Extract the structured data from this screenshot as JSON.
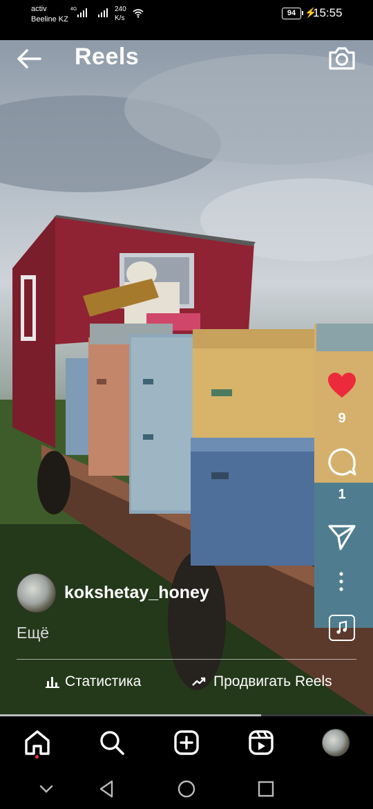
{
  "status_bar": {
    "carrier_line1": "activ",
    "carrier_line2": "Beeline KZ",
    "network_type": "4G",
    "speed_value": "240",
    "speed_unit": "K/s",
    "battery_level": "94",
    "time": "15:55"
  },
  "header": {
    "title": "Reels",
    "back_icon": "arrow-left-icon",
    "camera_icon": "camera-icon"
  },
  "actions": {
    "like_icon": "heart-filled-icon",
    "like_color": "#ed2a3c",
    "like_count": "9",
    "comment_icon": "comment-bubble-icon",
    "comment_count": "1",
    "share_icon": "paper-plane-icon",
    "more_icon": "vertical-dots-icon",
    "audio_icon": "music-note-icon"
  },
  "post": {
    "username": "kokshetay_honey",
    "more_label": "Ещё",
    "stats_label": "Статистика",
    "stats_icon": "bar-chart-icon",
    "promote_label": "Продвигать Reels",
    "promote_icon": "trending-up-icon"
  },
  "playback": {
    "progress_fraction": 0.7
  },
  "bottom_nav": {
    "items": [
      "home-icon",
      "search-icon",
      "create-plus-icon",
      "reels-icon",
      "profile-avatar"
    ],
    "active": "home-icon",
    "notification_dot_color": "#ff3040"
  },
  "system_nav": {
    "items": [
      "chevron-down-icon",
      "back-triangle-icon",
      "home-circle-icon",
      "recents-square-icon"
    ]
  }
}
